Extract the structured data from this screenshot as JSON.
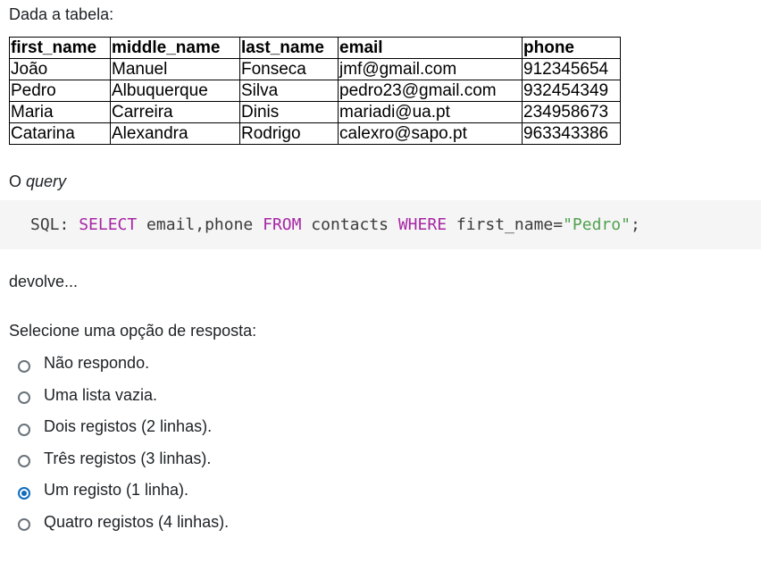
{
  "intro_text": "Dada a tabela:",
  "table": {
    "headers": [
      "first_name",
      "middle_name",
      "last_name",
      "email",
      "phone"
    ],
    "rows": [
      [
        "João",
        "Manuel",
        "Fonseca",
        "jmf@gmail.com",
        "912345654"
      ],
      [
        "Pedro",
        "Albuquerque",
        "Silva",
        "pedro23@gmail.com",
        "932454349"
      ],
      [
        "Maria",
        "Carreira",
        "Dinis",
        "mariadi@ua.pt",
        "234958673"
      ],
      [
        "Catarina",
        "Alexandra",
        "Rodrigo",
        "calexro@sapo.pt",
        "963343386"
      ]
    ]
  },
  "query_label": {
    "prefix": "O ",
    "emphasis": "query"
  },
  "code": {
    "prefix": "SQL: ",
    "kw_select": "SELECT",
    "cols": " email,phone ",
    "kw_from": "FROM",
    "table": " contacts ",
    "kw_where": "WHERE",
    "cond": " first_name=",
    "value": "\"Pedro\"",
    "end": ";"
  },
  "after_text": "devolve...",
  "prompt_text": "Selecione uma opção de resposta:",
  "options": [
    {
      "label": "Não respondo.",
      "checked": false
    },
    {
      "label": "Uma lista vazia.",
      "checked": false
    },
    {
      "label": "Dois registos (2 linhas).",
      "checked": false
    },
    {
      "label": "Três registos (3 linhas).",
      "checked": false
    },
    {
      "label": "Um registo (1 linha).",
      "checked": true
    },
    {
      "label": "Quatro registos (4 linhas).",
      "checked": false
    }
  ],
  "colors": {
    "keyword": "#a626a4",
    "string": "#50a14f",
    "radio_selected": "#0f6cbf"
  }
}
